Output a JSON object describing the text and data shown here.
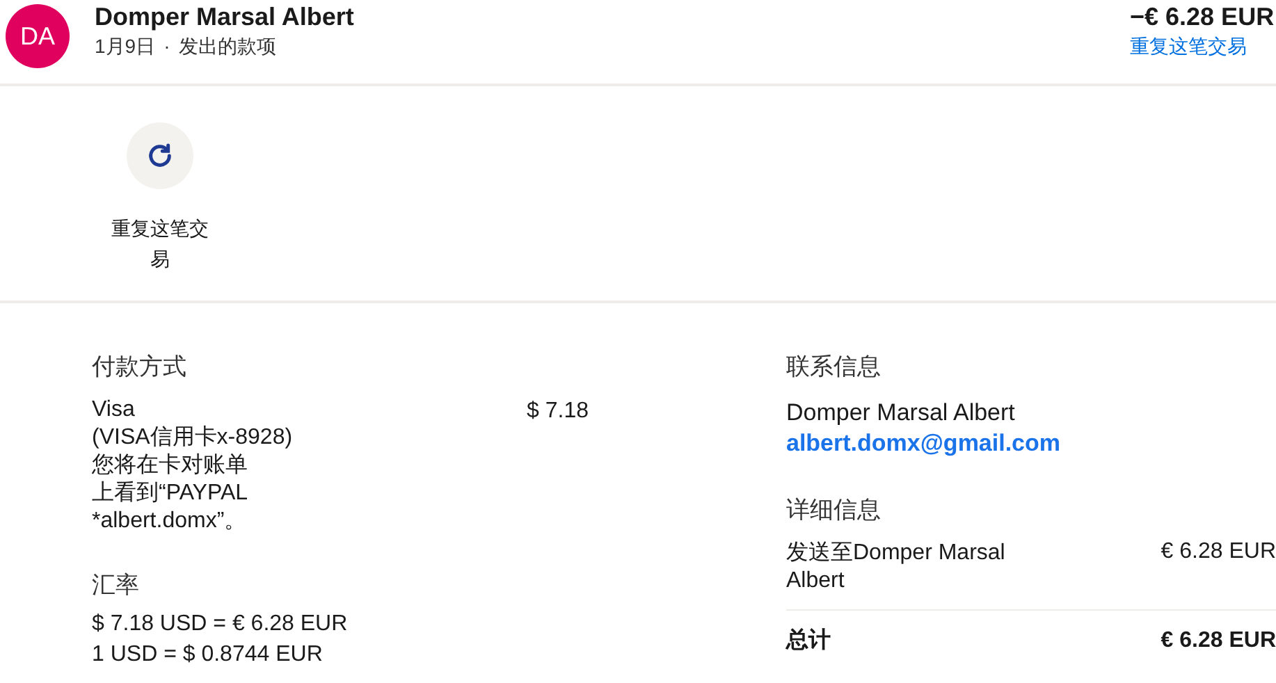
{
  "header": {
    "avatar": "DA",
    "name": "Domper Marsal Albert",
    "date": "1月9日",
    "separator": "·",
    "type": "发出的款项",
    "amount": "−€ 6.28 EUR",
    "repeat_link": "重复这笔交易"
  },
  "actions": [
    {
      "label": "重复这笔交易"
    }
  ],
  "payment": {
    "title": "付款方式",
    "method_lines": [
      "Visa",
      "(VISA信用卡x-8928)",
      "您将在卡对账单",
      "上看到“PAYPAL",
      "*albert.domx”。"
    ],
    "amount": "$ 7.18"
  },
  "exchange": {
    "title": "汇率",
    "lines": [
      "$ 7.18 USD = € 6.28 EUR",
      "1 USD = $ 0.8744 EUR"
    ]
  },
  "contact": {
    "title": "联系信息",
    "name": "Domper Marsal Albert",
    "email": "albert.domx@gmail.com"
  },
  "details": {
    "title": "详细信息",
    "rows": [
      {
        "label": "发送至Domper Marsal Albert",
        "amount": "€ 6.28 EUR",
        "kind": "item"
      },
      {
        "label": "总计",
        "amount": "€ 6.28 EUR",
        "kind": "total"
      }
    ]
  }
}
